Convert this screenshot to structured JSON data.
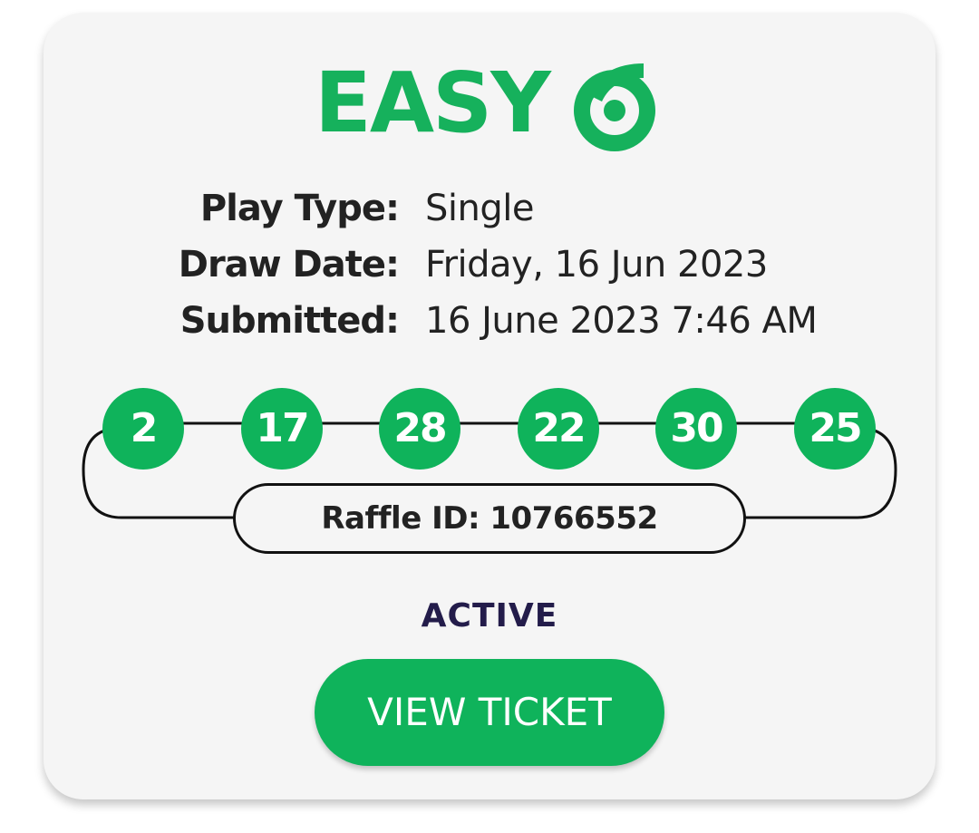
{
  "logo": {
    "text": "EASY",
    "digit": "6",
    "color": "#16b15c"
  },
  "info": {
    "play_type_label": "Play Type:",
    "play_type_value": "Single",
    "draw_date_label": "Draw Date:",
    "draw_date_value": "Friday, 16 Jun 2023",
    "submitted_label": "Submitted:",
    "submitted_value": "16 June 2023 7:46 AM"
  },
  "balls": [
    "2",
    "17",
    "28",
    "22",
    "30",
    "25"
  ],
  "raffle": {
    "text": "Raffle ID: 10766552"
  },
  "status": "ACTIVE",
  "button": {
    "label": "VIEW TICKET"
  },
  "colors": {
    "accent": "#0fb35b",
    "status": "#231c4a",
    "card_bg": "#f5f5f5"
  }
}
